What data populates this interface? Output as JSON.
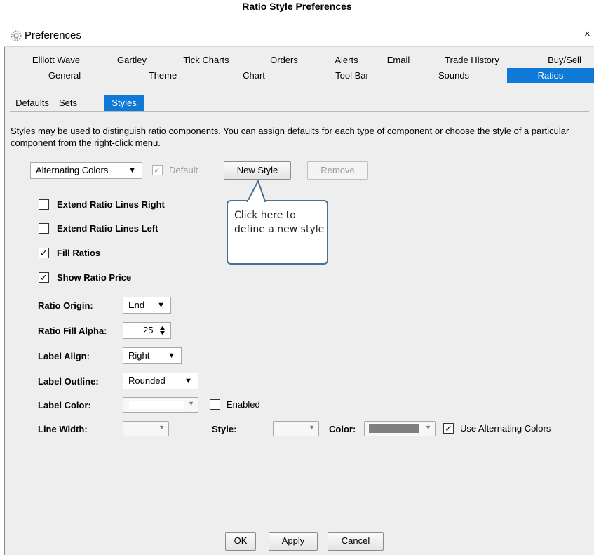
{
  "caption": "Ratio Style Preferences",
  "window": {
    "title": "Preferences",
    "close": "×"
  },
  "tabs_row1": [
    "Elliott Wave",
    "Gartley",
    "Tick Charts",
    "Orders",
    "Alerts",
    "Email",
    "Trade History",
    "Buy/Sell"
  ],
  "tabs_row2": [
    "General",
    "Theme",
    "Chart",
    "Tool Bar",
    "Sounds",
    "Ratios"
  ],
  "selected_tab": "Ratios",
  "subtabs": [
    "Defaults",
    "Sets",
    "Styles"
  ],
  "selected_subtab": "Styles",
  "description": "Styles may be used to distinguish ratio components. You can assign defaults for each type of component or choose the style of a particular component from the right-click menu.",
  "style_select": {
    "value": "Alternating Colors",
    "arrow": "▼"
  },
  "default_check": {
    "label": "Default",
    "checked": true
  },
  "buttons": {
    "new_style": "New Style",
    "remove": "Remove",
    "ok": "OK",
    "apply": "Apply",
    "cancel": "Cancel"
  },
  "callout": "Click here to define a new style",
  "checkboxes": [
    {
      "label": "Extend Ratio Lines Right",
      "checked": false
    },
    {
      "label": "Extend Ratio Lines Left",
      "checked": false
    },
    {
      "label": "Fill Ratios",
      "checked": true
    },
    {
      "label": "Show Ratio Price",
      "checked": true
    }
  ],
  "check_mark": "✓",
  "fields": {
    "ratio_origin": {
      "label": "Ratio Origin:",
      "value": "End"
    },
    "ratio_fill_alpha": {
      "label": "Ratio Fill Alpha:",
      "value": "25"
    },
    "label_align": {
      "label": "Label Align:",
      "value": "Right"
    },
    "label_outline": {
      "label": "Label Outline:",
      "value": "Rounded"
    },
    "label_color": {
      "label": "Label Color:",
      "color": "#ffffff"
    },
    "label_enabled": {
      "label": "Enabled",
      "checked": false
    },
    "line_width": {
      "label": "Line Width:"
    },
    "style": {
      "label": "Style:"
    },
    "color": {
      "label": "Color:",
      "color": "#7f7f7f"
    },
    "use_alternating": {
      "label": "Use Alternating Colors",
      "checked": true
    }
  },
  "colors": {
    "accent": "#0f79d7",
    "callout_border": "#4a6f95"
  }
}
